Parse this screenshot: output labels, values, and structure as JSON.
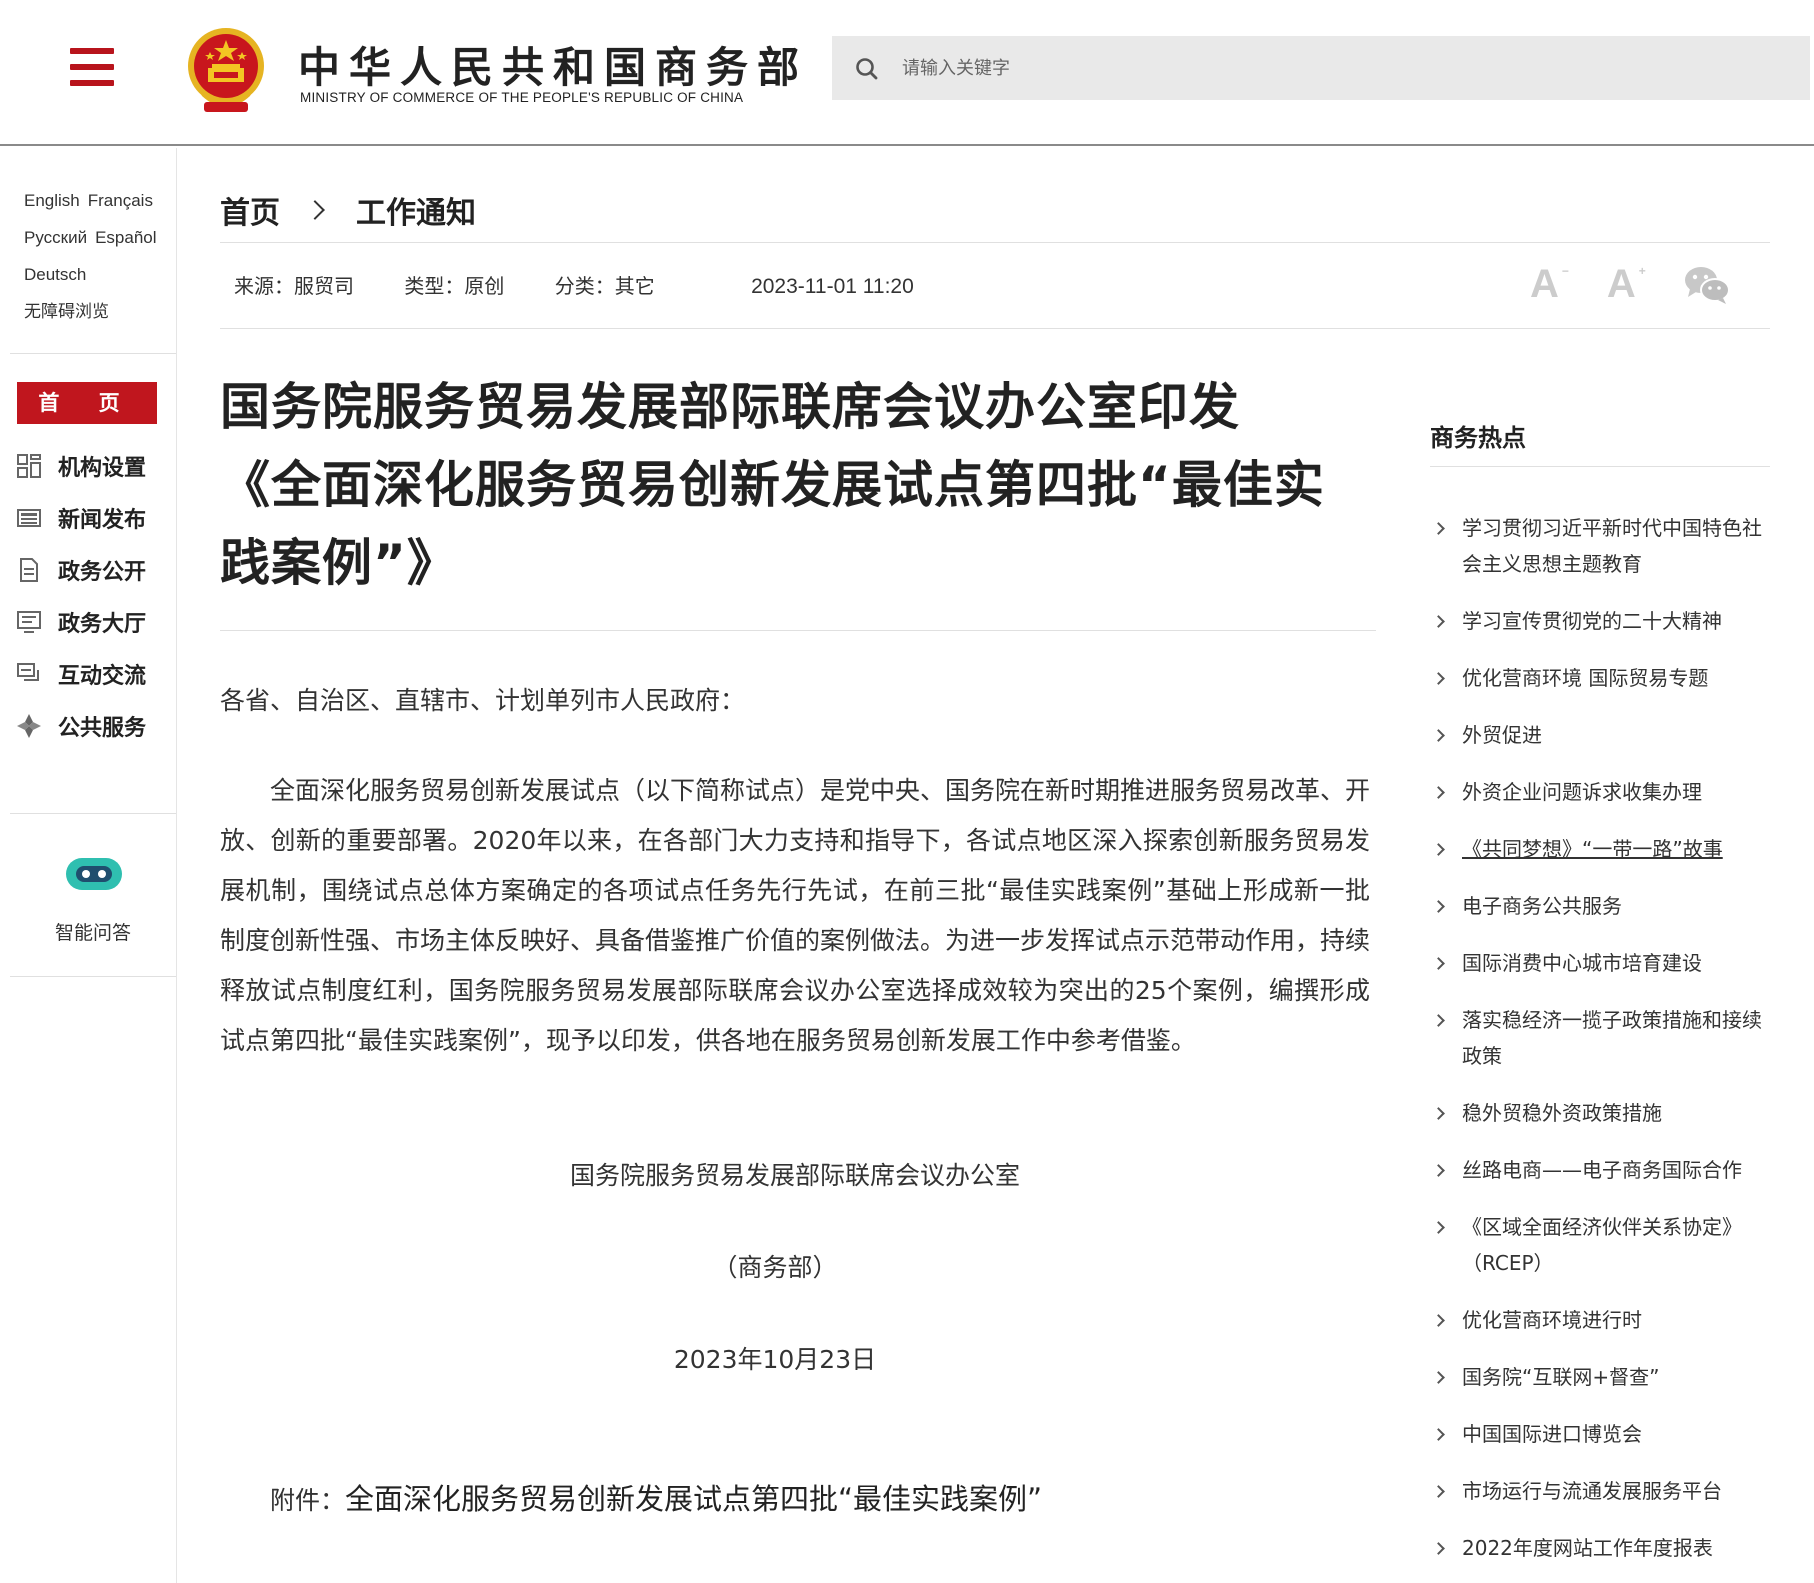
{
  "header": {
    "title": "中华人民共和国商务部",
    "subtitle": "MINISTRY OF COMMERCE OF THE PEOPLE'S REPUBLIC OF CHINA",
    "search_placeholder": "请输入关键字",
    "brand_color": "#c0161e"
  },
  "sidebar": {
    "languages": [
      "English",
      "Français",
      "Русский",
      "Español",
      "Deutsch"
    ],
    "accessibility": "无障碍浏览",
    "home": "首 页",
    "nav": [
      {
        "label": "机构设置",
        "icon": "grid-icon"
      },
      {
        "label": "新闻发布",
        "icon": "news-icon"
      },
      {
        "label": "政务公开",
        "icon": "document-icon"
      },
      {
        "label": "政务大厅",
        "icon": "monitor-icon"
      },
      {
        "label": "互动交流",
        "icon": "chat-icon"
      },
      {
        "label": "公共服务",
        "icon": "service-icon"
      }
    ],
    "assistant": "智能问答"
  },
  "breadcrumb": {
    "home": "首页",
    "current": "工作通知"
  },
  "meta": {
    "source": "来源：服贸司",
    "type": "类型：原创",
    "category": "分类：其它",
    "date": "2023-11-01 11:20"
  },
  "article": {
    "title": "国务院服务贸易发展部际联席会议办公室印发《全面深化服务贸易创新发展试点第四批“最佳实践案例”》",
    "salutation": "各省、自治区、直辖市、计划单列市人民政府：",
    "paragraph": "全面深化服务贸易创新发展试点（以下简称试点）是党中央、国务院在新时期推进服务贸易改革、开放、创新的重要部署。2020年以来，在各部门大力支持和指导下，各试点地区深入探索创新服务贸易发展机制，围绕试点总体方案确定的各项试点任务先行先试，在前三批“最佳实践案例”基础上形成新一批制度创新性强、市场主体反映好、具备借鉴推广价值的案例做法。为进一步发挥试点示范带动作用，持续释放试点制度红利，国务院服务贸易发展部际联席会议办公室选择成效较为突出的25个案例，编撰形成试点第四批“最佳实践案例”，现予以印发，供各地在服务贸易创新发展工作中参考借鉴。",
    "signature": "国务院服务贸易发展部际联席会议办公室",
    "signature2": "（商务部）",
    "sign_date": "2023年10月23日",
    "attachment_label": "附件：",
    "attachment_link": "全面深化服务贸易创新发展试点第四批“最佳实践案例”"
  },
  "hot": {
    "title": "商务热点",
    "items": [
      "学习贯彻习近平新时代中国特色社会主义思想主题教育",
      "学习宣传贯彻党的二十大精神",
      "优化营商环境 国际贸易专题",
      "外贸促进",
      "外资企业问题诉求收集办理",
      "《共同梦想》“一带一路”故事",
      "电子商务公共服务",
      "国际消费中心城市培育建设",
      "落实稳经济一揽子政策措施和接续政策",
      "稳外贸稳外资政策措施",
      "丝路电商——电子商务国际合作",
      "《区域全面经济伙伴关系协定》（RCEP）",
      "优化营商环境进行时",
      "国务院“互联网+督查”",
      "中国国际进口博览会",
      "市场运行与流通发展服务平台",
      "2022年度网站工作年度报表"
    ]
  }
}
